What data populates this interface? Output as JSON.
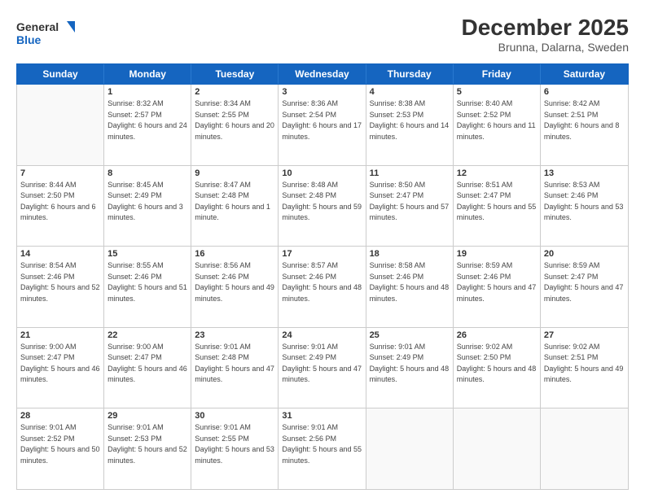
{
  "header": {
    "logo_general": "General",
    "logo_blue": "Blue",
    "title": "December 2025",
    "subtitle": "Brunna, Dalarna, Sweden"
  },
  "calendar": {
    "days_of_week": [
      "Sunday",
      "Monday",
      "Tuesday",
      "Wednesday",
      "Thursday",
      "Friday",
      "Saturday"
    ],
    "rows": [
      [
        {
          "day": "",
          "sunrise": "",
          "sunset": "",
          "daylight": ""
        },
        {
          "day": "1",
          "sunrise": "Sunrise: 8:32 AM",
          "sunset": "Sunset: 2:57 PM",
          "daylight": "Daylight: 6 hours and 24 minutes."
        },
        {
          "day": "2",
          "sunrise": "Sunrise: 8:34 AM",
          "sunset": "Sunset: 2:55 PM",
          "daylight": "Daylight: 6 hours and 20 minutes."
        },
        {
          "day": "3",
          "sunrise": "Sunrise: 8:36 AM",
          "sunset": "Sunset: 2:54 PM",
          "daylight": "Daylight: 6 hours and 17 minutes."
        },
        {
          "day": "4",
          "sunrise": "Sunrise: 8:38 AM",
          "sunset": "Sunset: 2:53 PM",
          "daylight": "Daylight: 6 hours and 14 minutes."
        },
        {
          "day": "5",
          "sunrise": "Sunrise: 8:40 AM",
          "sunset": "Sunset: 2:52 PM",
          "daylight": "Daylight: 6 hours and 11 minutes."
        },
        {
          "day": "6",
          "sunrise": "Sunrise: 8:42 AM",
          "sunset": "Sunset: 2:51 PM",
          "daylight": "Daylight: 6 hours and 8 minutes."
        }
      ],
      [
        {
          "day": "7",
          "sunrise": "Sunrise: 8:44 AM",
          "sunset": "Sunset: 2:50 PM",
          "daylight": "Daylight: 6 hours and 6 minutes."
        },
        {
          "day": "8",
          "sunrise": "Sunrise: 8:45 AM",
          "sunset": "Sunset: 2:49 PM",
          "daylight": "Daylight: 6 hours and 3 minutes."
        },
        {
          "day": "9",
          "sunrise": "Sunrise: 8:47 AM",
          "sunset": "Sunset: 2:48 PM",
          "daylight": "Daylight: 6 hours and 1 minute."
        },
        {
          "day": "10",
          "sunrise": "Sunrise: 8:48 AM",
          "sunset": "Sunset: 2:48 PM",
          "daylight": "Daylight: 5 hours and 59 minutes."
        },
        {
          "day": "11",
          "sunrise": "Sunrise: 8:50 AM",
          "sunset": "Sunset: 2:47 PM",
          "daylight": "Daylight: 5 hours and 57 minutes."
        },
        {
          "day": "12",
          "sunrise": "Sunrise: 8:51 AM",
          "sunset": "Sunset: 2:47 PM",
          "daylight": "Daylight: 5 hours and 55 minutes."
        },
        {
          "day": "13",
          "sunrise": "Sunrise: 8:53 AM",
          "sunset": "Sunset: 2:46 PM",
          "daylight": "Daylight: 5 hours and 53 minutes."
        }
      ],
      [
        {
          "day": "14",
          "sunrise": "Sunrise: 8:54 AM",
          "sunset": "Sunset: 2:46 PM",
          "daylight": "Daylight: 5 hours and 52 minutes."
        },
        {
          "day": "15",
          "sunrise": "Sunrise: 8:55 AM",
          "sunset": "Sunset: 2:46 PM",
          "daylight": "Daylight: 5 hours and 51 minutes."
        },
        {
          "day": "16",
          "sunrise": "Sunrise: 8:56 AM",
          "sunset": "Sunset: 2:46 PM",
          "daylight": "Daylight: 5 hours and 49 minutes."
        },
        {
          "day": "17",
          "sunrise": "Sunrise: 8:57 AM",
          "sunset": "Sunset: 2:46 PM",
          "daylight": "Daylight: 5 hours and 48 minutes."
        },
        {
          "day": "18",
          "sunrise": "Sunrise: 8:58 AM",
          "sunset": "Sunset: 2:46 PM",
          "daylight": "Daylight: 5 hours and 48 minutes."
        },
        {
          "day": "19",
          "sunrise": "Sunrise: 8:59 AM",
          "sunset": "Sunset: 2:46 PM",
          "daylight": "Daylight: 5 hours and 47 minutes."
        },
        {
          "day": "20",
          "sunrise": "Sunrise: 8:59 AM",
          "sunset": "Sunset: 2:47 PM",
          "daylight": "Daylight: 5 hours and 47 minutes."
        }
      ],
      [
        {
          "day": "21",
          "sunrise": "Sunrise: 9:00 AM",
          "sunset": "Sunset: 2:47 PM",
          "daylight": "Daylight: 5 hours and 46 minutes."
        },
        {
          "day": "22",
          "sunrise": "Sunrise: 9:00 AM",
          "sunset": "Sunset: 2:47 PM",
          "daylight": "Daylight: 5 hours and 46 minutes."
        },
        {
          "day": "23",
          "sunrise": "Sunrise: 9:01 AM",
          "sunset": "Sunset: 2:48 PM",
          "daylight": "Daylight: 5 hours and 47 minutes."
        },
        {
          "day": "24",
          "sunrise": "Sunrise: 9:01 AM",
          "sunset": "Sunset: 2:49 PM",
          "daylight": "Daylight: 5 hours and 47 minutes."
        },
        {
          "day": "25",
          "sunrise": "Sunrise: 9:01 AM",
          "sunset": "Sunset: 2:49 PM",
          "daylight": "Daylight: 5 hours and 48 minutes."
        },
        {
          "day": "26",
          "sunrise": "Sunrise: 9:02 AM",
          "sunset": "Sunset: 2:50 PM",
          "daylight": "Daylight: 5 hours and 48 minutes."
        },
        {
          "day": "27",
          "sunrise": "Sunrise: 9:02 AM",
          "sunset": "Sunset: 2:51 PM",
          "daylight": "Daylight: 5 hours and 49 minutes."
        }
      ],
      [
        {
          "day": "28",
          "sunrise": "Sunrise: 9:01 AM",
          "sunset": "Sunset: 2:52 PM",
          "daylight": "Daylight: 5 hours and 50 minutes."
        },
        {
          "day": "29",
          "sunrise": "Sunrise: 9:01 AM",
          "sunset": "Sunset: 2:53 PM",
          "daylight": "Daylight: 5 hours and 52 minutes."
        },
        {
          "day": "30",
          "sunrise": "Sunrise: 9:01 AM",
          "sunset": "Sunset: 2:55 PM",
          "daylight": "Daylight: 5 hours and 53 minutes."
        },
        {
          "day": "31",
          "sunrise": "Sunrise: 9:01 AM",
          "sunset": "Sunset: 2:56 PM",
          "daylight": "Daylight: 5 hours and 55 minutes."
        },
        {
          "day": "",
          "sunrise": "",
          "sunset": "",
          "daylight": ""
        },
        {
          "day": "",
          "sunrise": "",
          "sunset": "",
          "daylight": ""
        },
        {
          "day": "",
          "sunrise": "",
          "sunset": "",
          "daylight": ""
        }
      ]
    ]
  }
}
